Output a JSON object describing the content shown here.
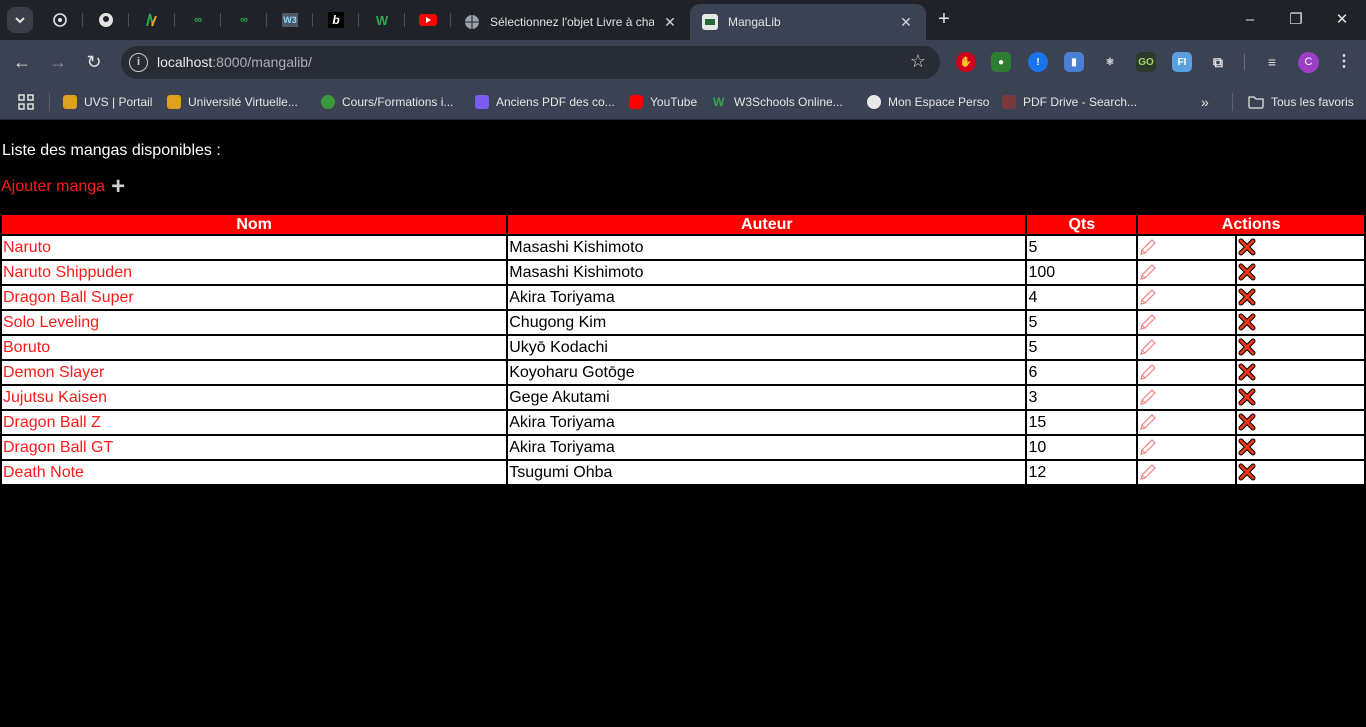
{
  "browser": {
    "tabs": [
      {
        "title": "Sélectionnez l'objet Livre à chan",
        "active": false
      },
      {
        "title": "MangaLib",
        "active": true
      }
    ],
    "url_host": "localhost",
    "url_rest": ":8000/mangalib/",
    "profile_initial": "C",
    "bookmarks": [
      "UVS | Portail",
      "Université Virtuelle...",
      "Cours/Formations i...",
      "Anciens PDF des co...",
      "YouTube",
      "W3Schools Online...",
      "Mon Espace Perso",
      "PDF Drive - Search..."
    ],
    "all_bookmarks_label": "Tous les favoris",
    "accent_colors": {
      "tabbar": "#1f2229",
      "toolbar": "#3b4253",
      "page_accent": "#ff0000"
    }
  },
  "page": {
    "heading": "Liste des mangas disponibles :",
    "add_label": "Ajouter manga",
    "columns": [
      "Nom",
      "Auteur",
      "Qts",
      "Actions"
    ],
    "rows": [
      {
        "nom": "Naruto",
        "auteur": "Masashi Kishimoto",
        "qts": "5"
      },
      {
        "nom": "Naruto Shippuden",
        "auteur": "Masashi Kishimoto",
        "qts": "100"
      },
      {
        "nom": "Dragon Ball Super",
        "auteur": "Akira Toriyama",
        "qts": "4"
      },
      {
        "nom": "Solo Leveling",
        "auteur": "Chugong Kim",
        "qts": "5"
      },
      {
        "nom": "Boruto",
        "auteur": "Ukyō Kodachi",
        "qts": "5"
      },
      {
        "nom": "Demon Slayer",
        "auteur": "Koyoharu Gotōge",
        "qts": "6"
      },
      {
        "nom": "Jujutsu Kaisen",
        "auteur": "Gege Akutami",
        "qts": "3"
      },
      {
        "nom": "Dragon Ball Z",
        "auteur": "Akira Toriyama",
        "qts": "15"
      },
      {
        "nom": "Dragon Ball GT",
        "auteur": "Akira Toriyama",
        "qts": "10"
      },
      {
        "nom": "Death Note",
        "auteur": "Tsugumi Ohba",
        "qts": "12"
      }
    ],
    "action_icons": [
      "pencil-icon",
      "delete-x-icon"
    ]
  }
}
